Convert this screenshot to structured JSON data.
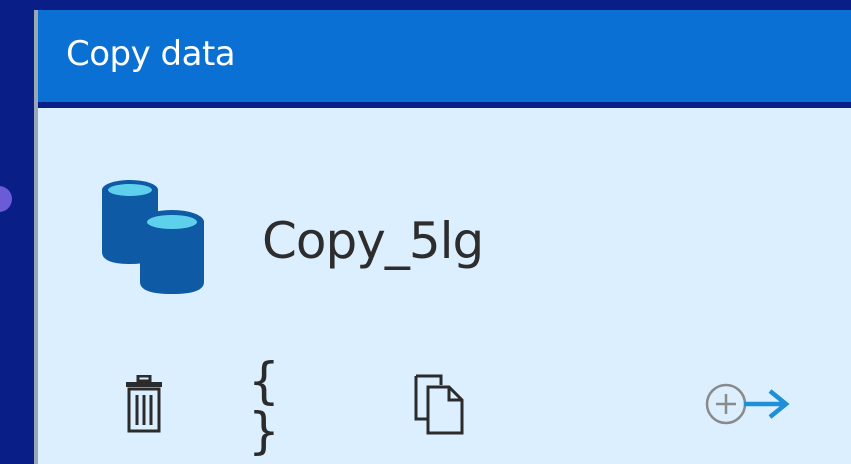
{
  "activity": {
    "type_label": "Copy data",
    "name": "Copy_5lg",
    "icon": "database-copy-icon"
  },
  "toolbar": {
    "delete_icon": "trash-icon",
    "code_icon": "code-braces-icon",
    "code_glyph": "{ }",
    "clone_icon": "copy-icon",
    "connect_icon": "add-output-icon"
  },
  "colors": {
    "canvas": "#0a1e88",
    "header": "#0a70d4",
    "body": "#dcefff",
    "connector": "#6b5bd6",
    "db_top": "#5fd0ec",
    "db_body": "#0e5aa5",
    "accent_arrow": "#1f8fd6"
  }
}
